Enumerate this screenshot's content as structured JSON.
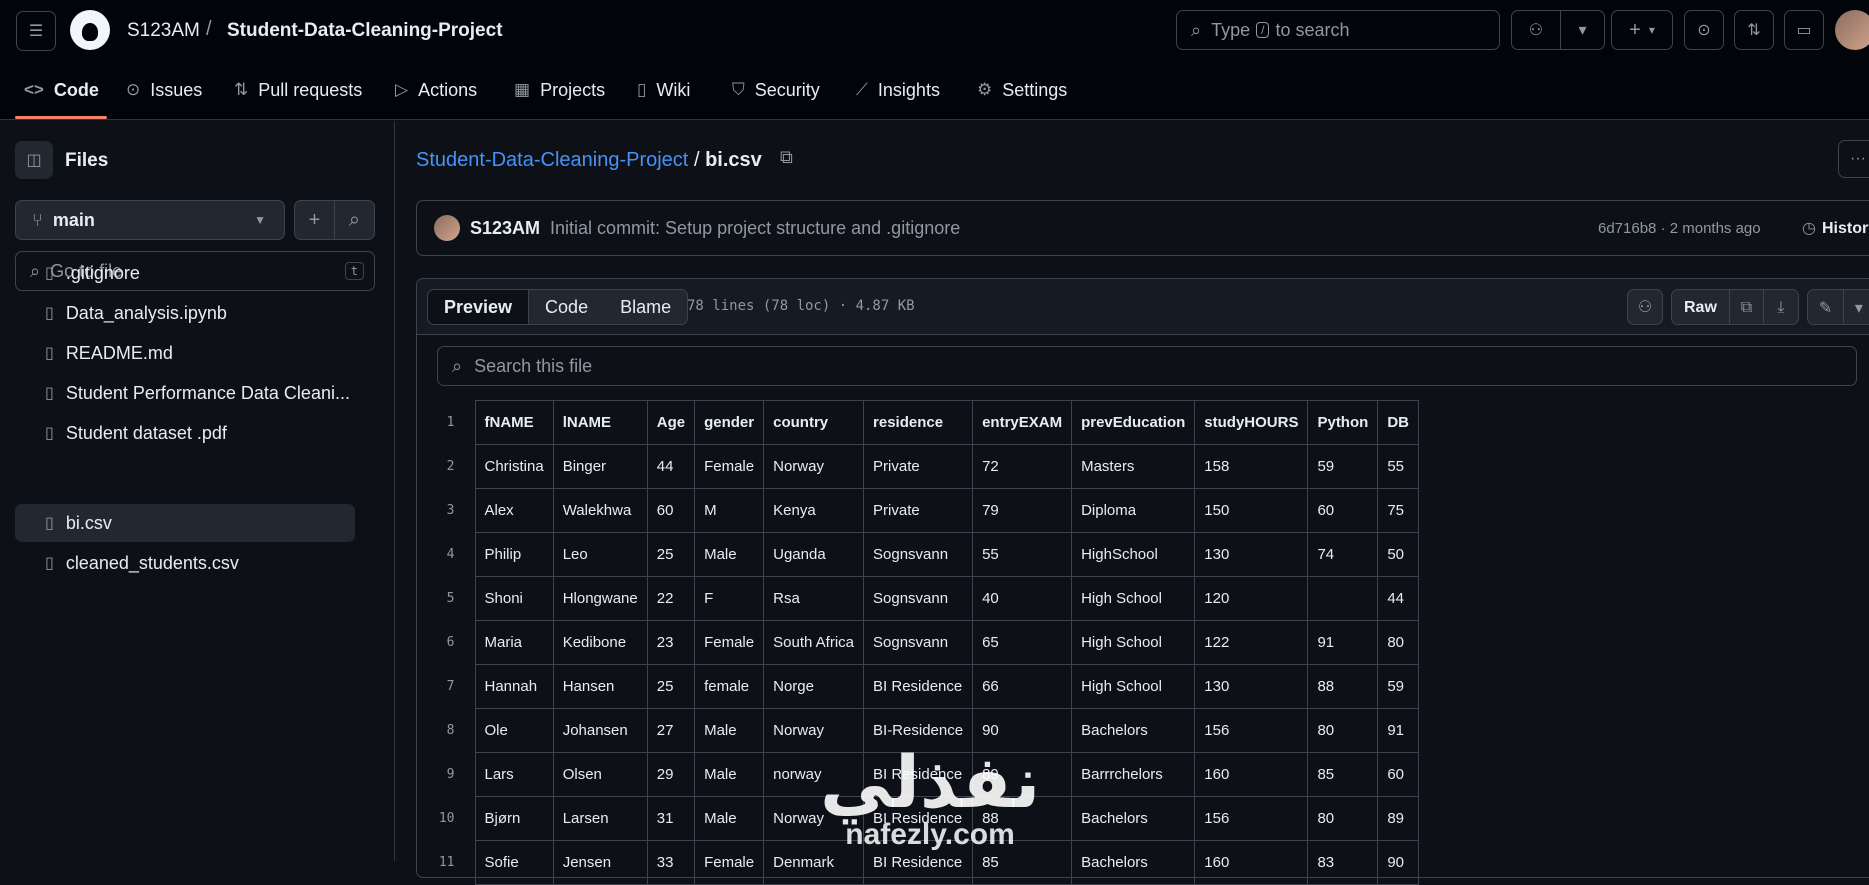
{
  "header": {
    "owner": "S123AM",
    "separator": "/",
    "repo": "Student-Data-Cleaning-Project",
    "search_prefix": "Type",
    "search_key": "/",
    "search_suffix": "to search"
  },
  "nav_tabs": [
    {
      "label": "Code",
      "icon": "code-icon"
    },
    {
      "label": "Issues",
      "icon": "issue-icon"
    },
    {
      "label": "Pull requests",
      "icon": "pull-request-icon"
    },
    {
      "label": "Actions",
      "icon": "play-icon"
    },
    {
      "label": "Projects",
      "icon": "table-icon"
    },
    {
      "label": "Wiki",
      "icon": "book-icon"
    },
    {
      "label": "Security",
      "icon": "shield-icon"
    },
    {
      "label": "Insights",
      "icon": "graph-icon"
    },
    {
      "label": "Settings",
      "icon": "gear-icon"
    }
  ],
  "sidebar": {
    "title": "Files",
    "branch": "main",
    "goto_placeholder": "Go to file",
    "goto_key": "t",
    "files": [
      ".gitignore",
      "Data_analysis.ipynb",
      "README.md",
      "Student Performance Data Cleani...",
      "Student dataset .pdf",
      "bi.csv",
      "cleaned_students.csv"
    ],
    "selected_index": 5
  },
  "main": {
    "path_repo": "Student-Data-Cleaning-Project",
    "path_sep": "/",
    "path_file": "bi.csv",
    "commit_author": "S123AM",
    "commit_message": "Initial commit: Setup project structure and .gitignore",
    "commit_meta": "6d716b8 · 2 months ago",
    "history_label": "History",
    "view_tabs": [
      "Preview",
      "Code",
      "Blame"
    ],
    "file_meta": "78 lines (78 loc) · 4.87 KB",
    "raw_label": "Raw",
    "search_placeholder": "Search this file"
  },
  "table": {
    "rows": [
      [
        "1",
        "fNAME",
        "lNAME",
        "Age",
        "gender",
        "country",
        "residence",
        "entryEXAM",
        "prevEducation",
        "studyHOURS",
        "Python",
        "DB"
      ],
      [
        "2",
        "Christina",
        "Binger",
        "44",
        "Female",
        "Norway",
        "Private",
        "72",
        "Masters",
        "158",
        "59",
        "55"
      ],
      [
        "3",
        "Alex",
        "Walekhwa",
        "60",
        "M",
        "Kenya",
        "Private",
        "79",
        "Diploma",
        "150",
        "60",
        "75"
      ],
      [
        "4",
        "Philip",
        "Leo",
        "25",
        "Male",
        "Uganda",
        "Sognsvann",
        "55",
        "HighSchool",
        "130",
        "74",
        "50"
      ],
      [
        "5",
        "Shoni",
        "Hlongwane",
        "22",
        "F",
        "Rsa",
        "Sognsvann",
        "40",
        "High School",
        "120",
        "",
        "44"
      ],
      [
        "6",
        "Maria",
        "Kedibone",
        "23",
        "Female",
        "South Africa",
        "Sognsvann",
        "65",
        "High School",
        "122",
        "91",
        "80"
      ],
      [
        "7",
        "Hannah",
        "Hansen",
        "25",
        "female",
        "Norge",
        "BI Residence",
        "66",
        "High School",
        "130",
        "88",
        "59"
      ],
      [
        "8",
        "Ole",
        "Johansen",
        "27",
        "Male",
        "Norway",
        "BI-Residence",
        "90",
        "Bachelors",
        "156",
        "80",
        "91"
      ],
      [
        "9",
        "Lars",
        "Olsen",
        "29",
        "Male",
        "norway",
        "BI Residence",
        "89",
        "Barrrchelors",
        "160",
        "85",
        "60"
      ],
      [
        "10",
        "Bjørn",
        "Larsen",
        "31",
        "Male",
        "Norway",
        "BI Residence",
        "88",
        "Bachelors",
        "156",
        "80",
        "89"
      ],
      [
        "11",
        "Sofie",
        "Jensen",
        "33",
        "Female",
        "Denmark",
        "BI Residence",
        "85",
        "Bachelors",
        "160",
        "83",
        "90"
      ]
    ]
  },
  "watermark": {
    "arabic": "نفذلي",
    "latin": "nafezly.com"
  }
}
